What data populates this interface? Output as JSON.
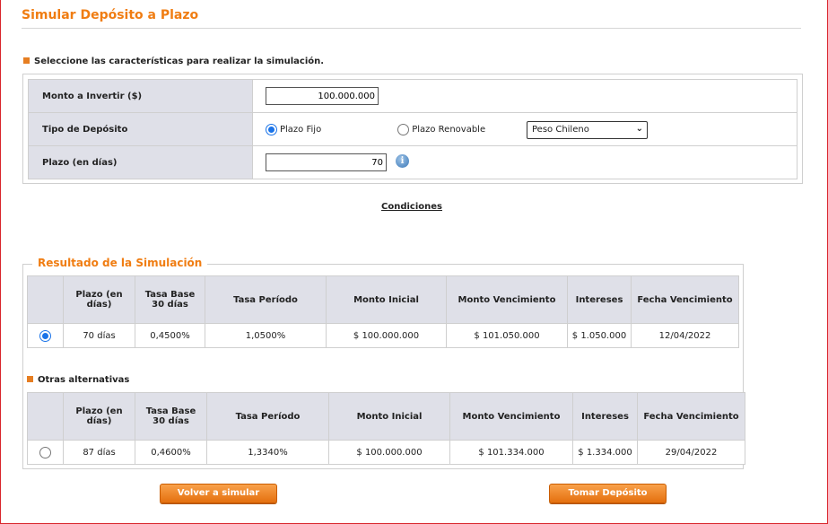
{
  "page": {
    "title": "Simular Depósito a Plazo"
  },
  "form": {
    "section_label": "Seleccione las características para realizar la simulación.",
    "amount_label": "Monto a Invertir ($)",
    "amount_value": "100.000.000",
    "type_label": "Tipo de Depósito",
    "type_options": [
      {
        "label": "Plazo Fijo",
        "selected": true
      },
      {
        "label": "Plazo Renovable",
        "selected": false
      }
    ],
    "currency_selected": "Peso Chileno",
    "term_label": "Plazo (en días)",
    "term_value": "70",
    "info_icon": "info-icon"
  },
  "conditions_link": "Condiciones",
  "results": {
    "title": "Resultado de la Simulación",
    "columns": [
      "Plazo (en días)",
      "Tasa Base 30 días",
      "Tasa Período",
      "Monto Inicial",
      "Monto Vencimiento",
      "Intereses",
      "Fecha Vencimiento"
    ],
    "row": {
      "selected": true,
      "cells": [
        "70 días",
        "0,4500%",
        "1,0500%",
        "$ 100.000.000",
        "$ 101.050.000",
        "$ 1.050.000",
        "12/04/2022"
      ]
    }
  },
  "alternatives": {
    "label": "Otras alternativas",
    "columns": [
      "Plazo (en días)",
      "Tasa Base 30 días",
      "Tasa Período",
      "Monto Inicial",
      "Monto Vencimiento",
      "Intereses",
      "Fecha Vencimiento"
    ],
    "row": {
      "selected": false,
      "cells": [
        "87 días",
        "0,4600%",
        "1,3340%",
        "$ 100.000.000",
        "$ 101.334.000",
        "$ 1.334.000",
        "29/04/2022"
      ]
    }
  },
  "buttons": {
    "back": "Volver a simular",
    "take": "Tomar Depósito"
  },
  "colors": {
    "accent": "#f07d12",
    "header_bg": "#dfe0e8",
    "frame": "#d9262c",
    "radio": "#1a73e8"
  }
}
